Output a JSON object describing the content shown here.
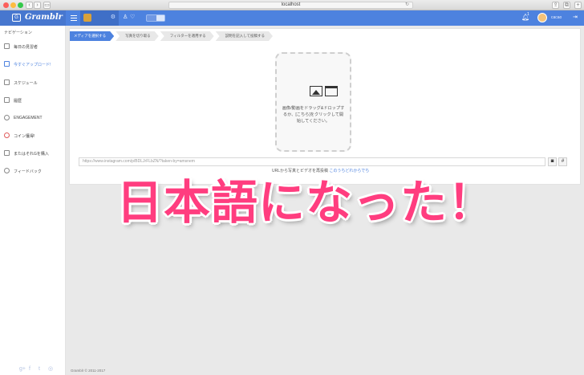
{
  "browser": {
    "url": "localhost",
    "back": "‹",
    "forward": "›",
    "sidebar": "▭",
    "reload": "↻",
    "share": "⇪",
    "tabs": "⧉",
    "add": "+"
  },
  "header": {
    "logo_text": "Gramblr",
    "logo_icon": "G",
    "user_name": "cacao",
    "notification_count": "1",
    "accent_color": "#4d82df"
  },
  "sidebar": {
    "heading": "ナビゲーション",
    "items": [
      {
        "label": "毎日の見習者",
        "icon": "shield-icon"
      },
      {
        "label": "今すぐアップロード!",
        "icon": "upload-icon"
      },
      {
        "label": "スケジュール",
        "icon": "calendar-icon"
      },
      {
        "label": "履歴",
        "icon": "history-icon"
      },
      {
        "label": "ENGAGEMENT",
        "icon": "user-icon"
      },
      {
        "label": "コイン獲得!",
        "icon": "heart-icon"
      },
      {
        "label": "またはそれGを購入",
        "icon": "cart-icon"
      },
      {
        "label": "フィードバック",
        "icon": "question-icon"
      }
    ],
    "social": [
      "g+",
      "f",
      "t",
      "◎"
    ]
  },
  "main": {
    "steps": [
      "メディアを選択する",
      "写真を切り取る",
      "フィルターを適用する",
      "説明を記入して投稿する"
    ],
    "dropzone_text": "画像/動画をドラッグ&ドロップするか、[こちら]をクリックして開始してください。",
    "url_placeholder": "https://www.instagram.com/p/BDLJrFLbZN/?taken-by=amsnem",
    "insta_button": "◙",
    "hash_button": "#",
    "url_help": "URLから写真とビデオを再投稿",
    "url_help_link": "このうちどれからでち"
  },
  "overlay_text": "日本語になった！",
  "footer": "Gramblr © 2011-2017"
}
